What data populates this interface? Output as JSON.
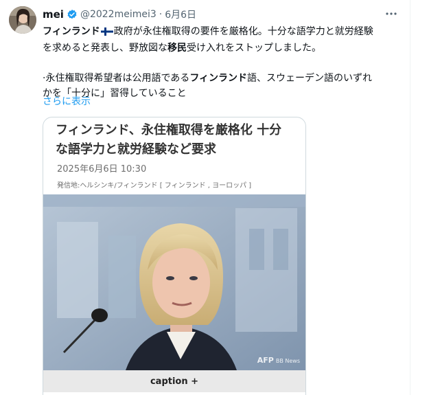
{
  "tweet": {
    "display_name": "mei",
    "handle": "@2022meimei3",
    "separator": "·",
    "date": "6月6日",
    "text": {
      "line1": {
        "bold_word": "フィンランド",
        "rest": "政府が永住権取得の要件を厳格化。十分な語学力と就労経験"
      },
      "line2": {
        "before_bold": "を求めると発表し、野放図な",
        "bold_word": "移民",
        "after_bold": "受け入れをストップしました。"
      },
      "line4": {
        "before_bold": "·永住権取得希望者は公用語である",
        "bold_word": "フィンランド",
        "after_bold": "語、スウェーデン語のいずれ"
      },
      "line5": "かを「十分に」習得していること"
    },
    "show_more": "さらに表示"
  },
  "card": {
    "title_line1": "フィンランド、永住権取得を厳格化 十分",
    "title_line2": "な語学力と就労経験など要求",
    "date": "2025年6月6日 10:30",
    "source": "発信地:ヘルシンキ/フィンランド [ フィンランド , ヨーロッパ ]",
    "photo_credit": "AFP",
    "photo_credit_small": "BB News",
    "caption": "caption +"
  },
  "icons": {
    "verified": "verified-badge-icon",
    "more": "more-options-icon",
    "flag": "finland-flag-icon"
  },
  "colors": {
    "link": "#1d9bf0",
    "verified": "#1d9bf0",
    "secondary_text": "#536471",
    "flag_blue": "#003580"
  }
}
